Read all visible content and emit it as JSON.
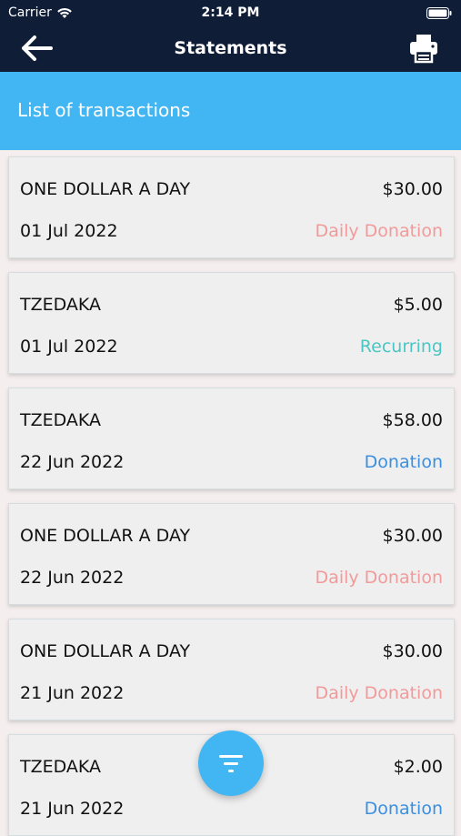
{
  "status_bar": {
    "carrier": "Carrier",
    "time": "2:14 PM"
  },
  "nav": {
    "title": "Statements",
    "back_icon": "back-arrow-icon",
    "print_icon": "printer-icon"
  },
  "section": {
    "label": "List of transactions"
  },
  "transactions": [
    {
      "name": "ONE DOLLAR A DAY",
      "amount": "$30.00",
      "date": "01 Jul 2022",
      "type": "Daily Donation",
      "type_color": "#f29a9a"
    },
    {
      "name": "TZEDAKA",
      "amount": "$5.00",
      "date": "01 Jul 2022",
      "type": "Recurring",
      "type_color": "#4cc6c4"
    },
    {
      "name": "TZEDAKA",
      "amount": "$58.00",
      "date": "22 Jun 2022",
      "type": "Donation",
      "type_color": "#3a8fe0"
    },
    {
      "name": "ONE DOLLAR A DAY",
      "amount": "$30.00",
      "date": "22 Jun 2022",
      "type": "Daily Donation",
      "type_color": "#f29a9a"
    },
    {
      "name": "ONE DOLLAR A DAY",
      "amount": "$30.00",
      "date": "21 Jun 2022",
      "type": "Daily Donation",
      "type_color": "#f29a9a"
    },
    {
      "name": "TZEDAKA",
      "amount": "$2.00",
      "date": "21 Jun 2022",
      "type": "Donation",
      "type_color": "#3a8fe0"
    }
  ],
  "fab": {
    "icon": "filter-icon"
  },
  "colors": {
    "nav_bg": "#0f1d36",
    "accent": "#42b5f3"
  }
}
